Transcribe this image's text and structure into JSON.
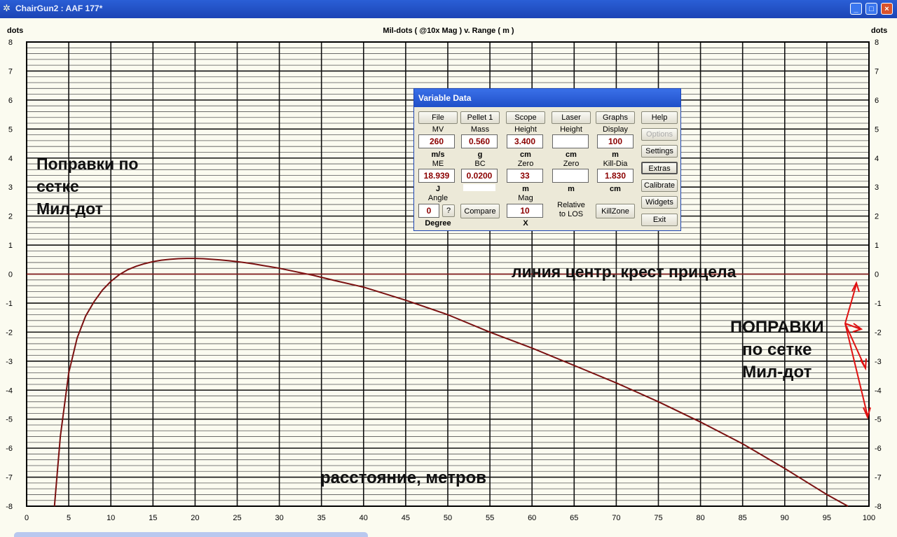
{
  "window": {
    "title": "ChairGun2 : AAF 177*",
    "minimize": "_",
    "restore": "□",
    "close": "×"
  },
  "chart_data": {
    "type": "line",
    "title": "Mil-dots ( @10x Mag ) v. Range ( m )",
    "ylabel_left": "dots",
    "ylabel_right": "dots",
    "xlim": [
      0,
      100
    ],
    "ylim": [
      -8,
      8
    ],
    "x_ticks": [
      0,
      5,
      10,
      15,
      20,
      25,
      30,
      35,
      40,
      45,
      50,
      55,
      60,
      65,
      70,
      75,
      80,
      85,
      90,
      95,
      100
    ],
    "y_ticks": [
      8,
      7,
      6,
      5,
      4,
      3,
      2,
      1,
      0,
      -1,
      -2,
      -3,
      -4,
      -5,
      -6,
      -7,
      -8
    ],
    "grid": true,
    "zero_line": 0,
    "series": [
      {
        "x": [
          3.3,
          4,
          5,
          6,
          7,
          8,
          9,
          10,
          11,
          12,
          13,
          14,
          15,
          16,
          17,
          18,
          19,
          20,
          21,
          22,
          23,
          24,
          25,
          26,
          27,
          28,
          29,
          30,
          31,
          32,
          33,
          34,
          35,
          37,
          40,
          45,
          50,
          55,
          60,
          65,
          70,
          75,
          80,
          85,
          90,
          95,
          97.5
        ],
        "y": [
          -8,
          -5.6,
          -3.4,
          -2.2,
          -1.45,
          -0.95,
          -0.55,
          -0.25,
          -0.02,
          0.15,
          0.27,
          0.36,
          0.43,
          0.48,
          0.51,
          0.53,
          0.54,
          0.54,
          0.53,
          0.51,
          0.49,
          0.46,
          0.43,
          0.39,
          0.35,
          0.3,
          0.25,
          0.2,
          0.14,
          0.08,
          0.02,
          -0.04,
          -0.11,
          -0.25,
          -0.45,
          -0.9,
          -1.4,
          -2.0,
          -2.55,
          -3.15,
          -3.75,
          -4.4,
          -5.1,
          -5.85,
          -6.7,
          -7.6,
          -8
        ]
      }
    ]
  },
  "annotations": {
    "left": "Поправки по\nсетке\nМил-дот",
    "crosshair": "линия центр. крест прицела",
    "right": "ПОПРАВКИ\nпо сетке\nМил-дот",
    "bottom": "расстояние, метров"
  },
  "dialog": {
    "title": "Variable Data",
    "buttons": {
      "file": "File",
      "pellet": "Pellet 1",
      "scope": "Scope",
      "laser": "Laser",
      "graphs": "Graphs",
      "help": "Help",
      "options": "Options",
      "settings": "Settings",
      "extras": "Extras",
      "calibrate": "Calibrate",
      "widgets": "Widgets",
      "exit": "Exit",
      "compare": "Compare",
      "killzone": "KillZone",
      "angle_q": "?"
    },
    "labels": {
      "mv": "MV",
      "mass": "Mass",
      "height": "Height",
      "laser_height": "Height",
      "display": "Display",
      "mv_unit": "m/s",
      "mass_unit": "g",
      "height_unit": "cm",
      "laser_height_unit": "cm",
      "display_unit": "m",
      "me": "ME",
      "bc": "BC",
      "zero": "Zero",
      "laser_zero": "Zero",
      "killdia": "Kill-Dia",
      "me_unit": "J",
      "zero_unit": "m",
      "laser_zero_unit": "m",
      "killdia_unit": "cm",
      "angle": "Angle",
      "mag": "Mag",
      "relative": "Relative\nto LOS",
      "angle_unit": "Degree",
      "mag_unit": "X"
    },
    "values": {
      "mv": "260",
      "mass": "0.560",
      "height": "3.400",
      "laser_height": "",
      "display": "100",
      "me": "18.939",
      "bc": "0.0200",
      "zero": "33",
      "laser_zero": "",
      "killdia": "1.830",
      "angle": "0",
      "mag": "10"
    }
  }
}
